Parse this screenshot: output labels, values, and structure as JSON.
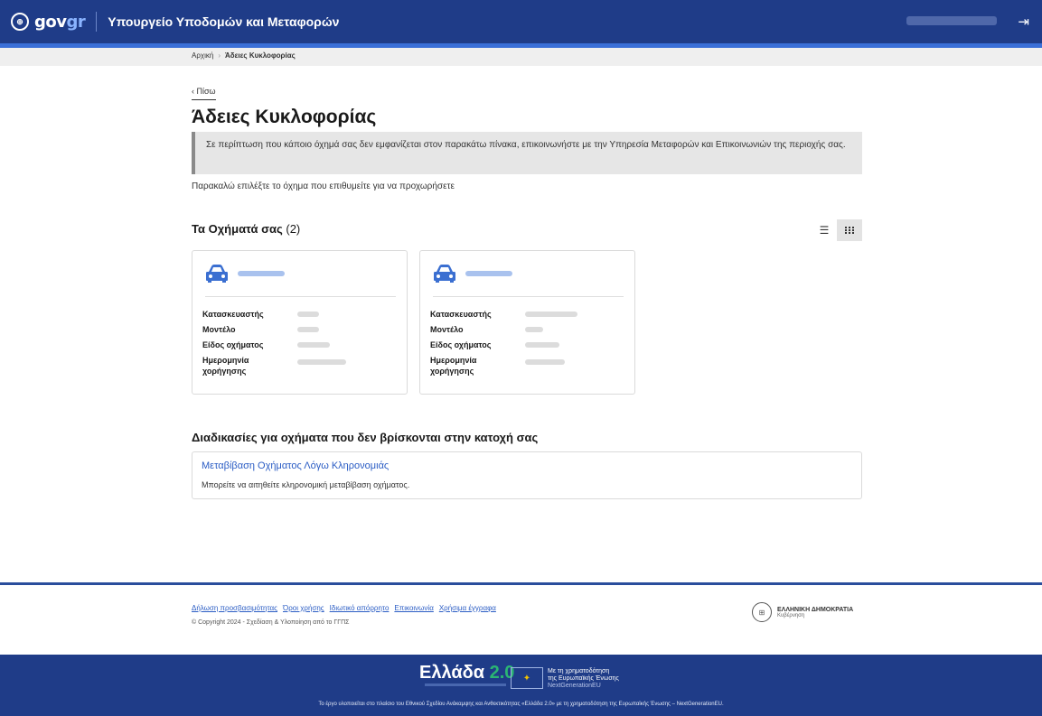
{
  "header": {
    "brand_gov": "gov",
    "brand_gr": "gr",
    "ministry": "Υπουργείο Υποδομών και Μεταφορών",
    "logout_icon": "logout-icon"
  },
  "breadcrumb": {
    "home": "Αρχική",
    "separator": "›",
    "current": "Άδειες Κυκλοφορίας"
  },
  "back_label": "‹ Πίσω",
  "page_title": "Άδειες Κυκλοφορίας",
  "notice": "Σε περίπτωση που κάποιο όχημά σας δεν εμφανίζεται στον παρακάτω πίνακα, επικοινωνήστε με την Υπηρεσία Μεταφορών και Επικοινωνιών της περιοχής σας.",
  "instruction": "Παρακαλώ επιλέξτε το όχημα που επιθυμείτε για να προχωρήσετε",
  "vehicles": {
    "title": "Τα Οχήματά σας",
    "count": "(2)",
    "list_view_icon": "list-view-icon",
    "grid_view_icon": "grid-view-icon",
    "cards": [
      {
        "icon": "car-icon",
        "labels": {
          "manufacturer": "Κατασκευαστής",
          "model": "Μοντέλο",
          "type": "Είδος οχήματος",
          "date": "Ημερομηνία χορήγησης"
        }
      },
      {
        "icon": "car-icon",
        "labels": {
          "manufacturer": "Κατασκευαστής",
          "model": "Μοντέλο",
          "type": "Είδος οχήματος",
          "date": "Ημερομηνία χορήγησης"
        }
      }
    ]
  },
  "procedures": {
    "title": "Διαδικασίες για οχήματα που δεν βρίσκονται στην κατοχή σας",
    "link": "Μεταβίβαση Οχήματος Λόγω Κληρονομιάς",
    "description": "Μπορείτε να αιτηθείτε κληρονομική μεταβίβαση οχήματος."
  },
  "footer": {
    "links": [
      "Δήλωση προσβασιμότητας",
      "Όροι χρήσης",
      "Ιδιωτικό απόρρητο",
      "Επικοινωνία",
      "Χρήσιμα έγγραφα"
    ],
    "copyright": "© Copyright 2024 - Σχεδίαση & Υλοποίηση από το ΓΓΠΣ",
    "hellenic_name": "ΕΛΛΗΝΙΚΗ ΔΗΜΟΚΡΑΤΙΑ",
    "hellenic_sub": "Κυβέρνηση",
    "ellada": "Ελλάδα",
    "ellada_ver": "2.0",
    "eu_line1": "Με τη χρηματοδότηση",
    "eu_line2": "της Ευρωπαϊκής Ένωσης",
    "eu_line3": "NextGenerationEU",
    "note": "Το έργο υλοποιείται στο πλαίσιο του Εθνικού Σχεδίου Ανάκαμψης και Ανθεκτικότητας «Ελλάδα 2.0» με τη χρηματοδότηση της Ευρωπαϊκής Ένωσης – NextGenerationEU."
  },
  "colors": {
    "header_blue": "#1f3c88",
    "accent_blue": "#2a5cc4",
    "car_icon_blue": "#3b6fd1"
  }
}
